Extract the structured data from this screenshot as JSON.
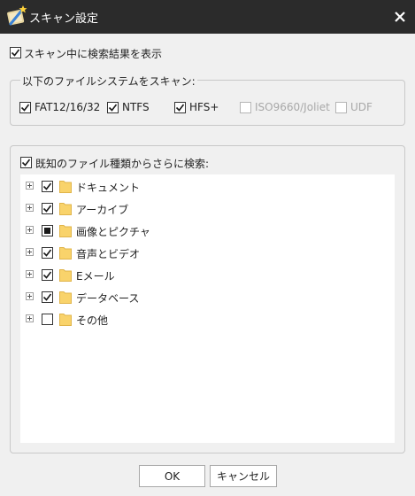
{
  "window": {
    "title": "スキャン設定"
  },
  "show_results": {
    "label": "スキャン中に検索結果を表示",
    "checked": true
  },
  "filesystems": {
    "legend": "以下のファイルシステムをスキャン:",
    "items": [
      {
        "label": "FAT12/16/32",
        "checked": true,
        "enabled": true
      },
      {
        "label": "NTFS",
        "checked": true,
        "enabled": true
      },
      {
        "label": "HFS+",
        "checked": true,
        "enabled": true
      },
      {
        "label": "ISO9660/Joliet",
        "checked": false,
        "enabled": false
      },
      {
        "label": "UDF",
        "checked": false,
        "enabled": false
      }
    ]
  },
  "filetypes": {
    "label": "既知のファイル種類からさらに検索:",
    "checked": true,
    "tree": [
      {
        "label": "ドキュメント",
        "state": "checked"
      },
      {
        "label": "アーカイブ",
        "state": "checked"
      },
      {
        "label": "画像とピクチャ",
        "state": "partial"
      },
      {
        "label": "音声とビデオ",
        "state": "checked"
      },
      {
        "label": "Eメール",
        "state": "checked"
      },
      {
        "label": "データベース",
        "state": "checked"
      },
      {
        "label": "その他",
        "state": "unchecked"
      }
    ]
  },
  "buttons": {
    "ok": "OK",
    "cancel": "キャンセル"
  },
  "colors": {
    "titlebar": "#2b2b2b",
    "check": "#1a1a1a",
    "folder": "#f9d36b",
    "disabled_text": "#a8a8a8"
  },
  "icons": {
    "app": "magic-wand-icon",
    "close": "close-icon",
    "folder": "folder-icon",
    "expander": "plus-box-icon"
  }
}
